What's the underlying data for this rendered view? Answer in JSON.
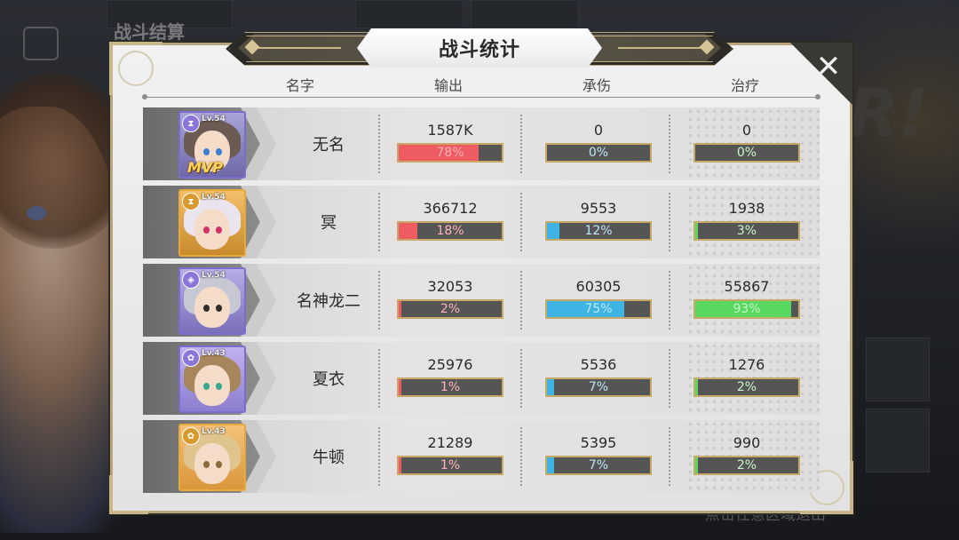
{
  "background": {
    "title": "战斗结算",
    "exit_hint": "点击任意区域退出",
    "mark": "R!"
  },
  "panel": {
    "title": "战斗统计",
    "close_icon": "close-icon",
    "headers": {
      "name": "名字",
      "output": "输出",
      "damage_taken": "承伤",
      "healing": "治疗"
    }
  },
  "colors": {
    "output": "#ef5b62",
    "damage_taken": "#3fb4e4",
    "healing": "#59d860",
    "border_gold": "#c9a968"
  },
  "rows": [
    {
      "name": "无名",
      "level": "Lv.54",
      "mvp": "MVP",
      "rarity": "purple",
      "badge_icon": "hourglass-icon",
      "output": {
        "value": "1587K",
        "percent_label": "78%",
        "percent": 78
      },
      "damage_taken": {
        "value": "0",
        "percent_label": "0%",
        "percent": 0
      },
      "healing": {
        "value": "0",
        "percent_label": "0%",
        "percent": 0
      }
    },
    {
      "name": "冥",
      "level": "Lv.54",
      "mvp": "",
      "rarity": "gold",
      "badge_icon": "hourglass-icon",
      "output": {
        "value": "366712",
        "percent_label": "18%",
        "percent": 18
      },
      "damage_taken": {
        "value": "9553",
        "percent_label": "12%",
        "percent": 12
      },
      "healing": {
        "value": "1938",
        "percent_label": "3%",
        "percent": 3
      }
    },
    {
      "name": "名神龙二",
      "level": "Lv.54",
      "mvp": "",
      "rarity": "purple",
      "badge_icon": "shield-icon",
      "output": {
        "value": "32053",
        "percent_label": "2%",
        "percent": 2
      },
      "damage_taken": {
        "value": "60305",
        "percent_label": "75%",
        "percent": 75
      },
      "healing": {
        "value": "55867",
        "percent_label": "93%",
        "percent": 93
      }
    },
    {
      "name": "夏衣",
      "level": "Lv.43",
      "mvp": "",
      "rarity": "purple",
      "badge_icon": "flower-icon",
      "output": {
        "value": "25976",
        "percent_label": "1%",
        "percent": 1
      },
      "damage_taken": {
        "value": "5536",
        "percent_label": "7%",
        "percent": 7
      },
      "healing": {
        "value": "1276",
        "percent_label": "2%",
        "percent": 2
      }
    },
    {
      "name": "牛顿",
      "level": "Lv.43",
      "mvp": "",
      "rarity": "gold",
      "badge_icon": "flower-icon",
      "output": {
        "value": "21289",
        "percent_label": "1%",
        "percent": 1
      },
      "damage_taken": {
        "value": "5395",
        "percent_label": "7%",
        "percent": 7
      },
      "healing": {
        "value": "990",
        "percent_label": "2%",
        "percent": 2
      }
    }
  ]
}
